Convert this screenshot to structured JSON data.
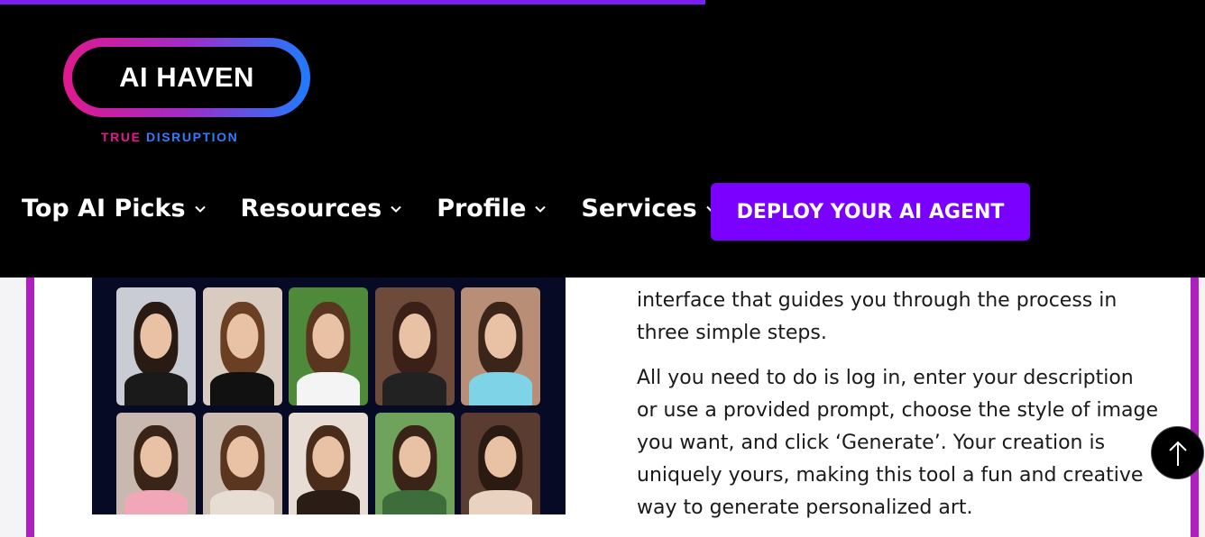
{
  "logo": {
    "name": "AI HAVEN",
    "tagline_part1": "TRUE",
    "tagline_part2": "DISRUPTION"
  },
  "nav": {
    "items": [
      {
        "label": "Top AI Picks"
      },
      {
        "label": "Resources"
      },
      {
        "label": "Profile"
      },
      {
        "label": "Services"
      }
    ],
    "cta_label": "DEPLOY YOUR AI AGENT"
  },
  "reading_progress": 0.585,
  "article": {
    "paragraph1": "interface that guides you through the process in three simple steps.",
    "paragraph2": "All you need to do is log in, enter your description or use a provided prompt, choose the style of image you want, and click ‘Generate’. Your creation is uniquely yours, making this tool a fun and creative way to generate personalized art."
  },
  "colors": {
    "accent": "#7a00ff",
    "progress": "#7a1ff0",
    "card_border": "#b01fbf",
    "header_bg": "#000000"
  },
  "icons": {
    "chevron": "chevron-down-icon",
    "scroll_top": "arrow-up-icon"
  }
}
